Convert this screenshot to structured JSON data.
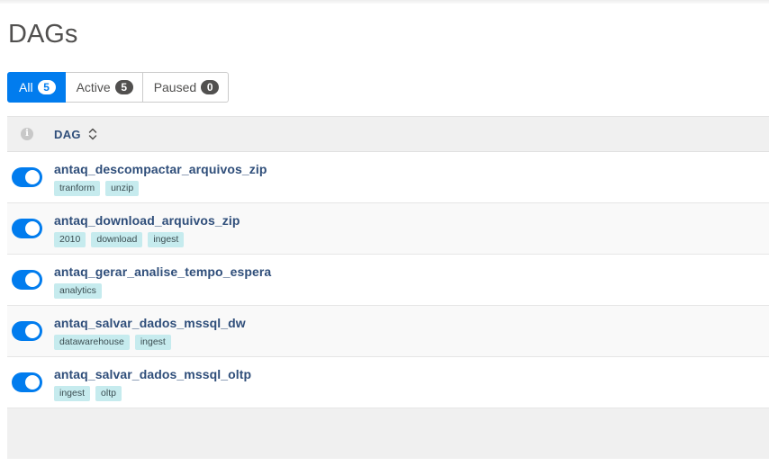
{
  "page": {
    "title": "DAGs"
  },
  "filters": [
    {
      "label": "All",
      "count": "5",
      "active": true
    },
    {
      "label": "Active",
      "count": "5",
      "active": false
    },
    {
      "label": "Paused",
      "count": "0",
      "active": false
    }
  ],
  "table": {
    "info_icon": "info-icon",
    "column_dag": "DAG",
    "sort_icon": "sort-icon"
  },
  "dags": [
    {
      "name": "antaq_descompactar_arquivos_zip",
      "enabled": true,
      "tags": [
        "tranform",
        "unzip"
      ]
    },
    {
      "name": "antaq_download_arquivos_zip",
      "enabled": true,
      "tags": [
        "2010",
        "download",
        "ingest"
      ]
    },
    {
      "name": "antaq_gerar_analise_tempo_espera",
      "enabled": true,
      "tags": [
        "analytics"
      ]
    },
    {
      "name": "antaq_salvar_dados_mssql_dw",
      "enabled": true,
      "tags": [
        "datawarehouse",
        "ingest"
      ]
    },
    {
      "name": "antaq_salvar_dados_mssql_oltp",
      "enabled": true,
      "tags": [
        "ingest",
        "oltp"
      ]
    }
  ],
  "colors": {
    "accent": "#017cee",
    "link": "#2f4e7a",
    "tag_bg": "#c6ebee"
  }
}
